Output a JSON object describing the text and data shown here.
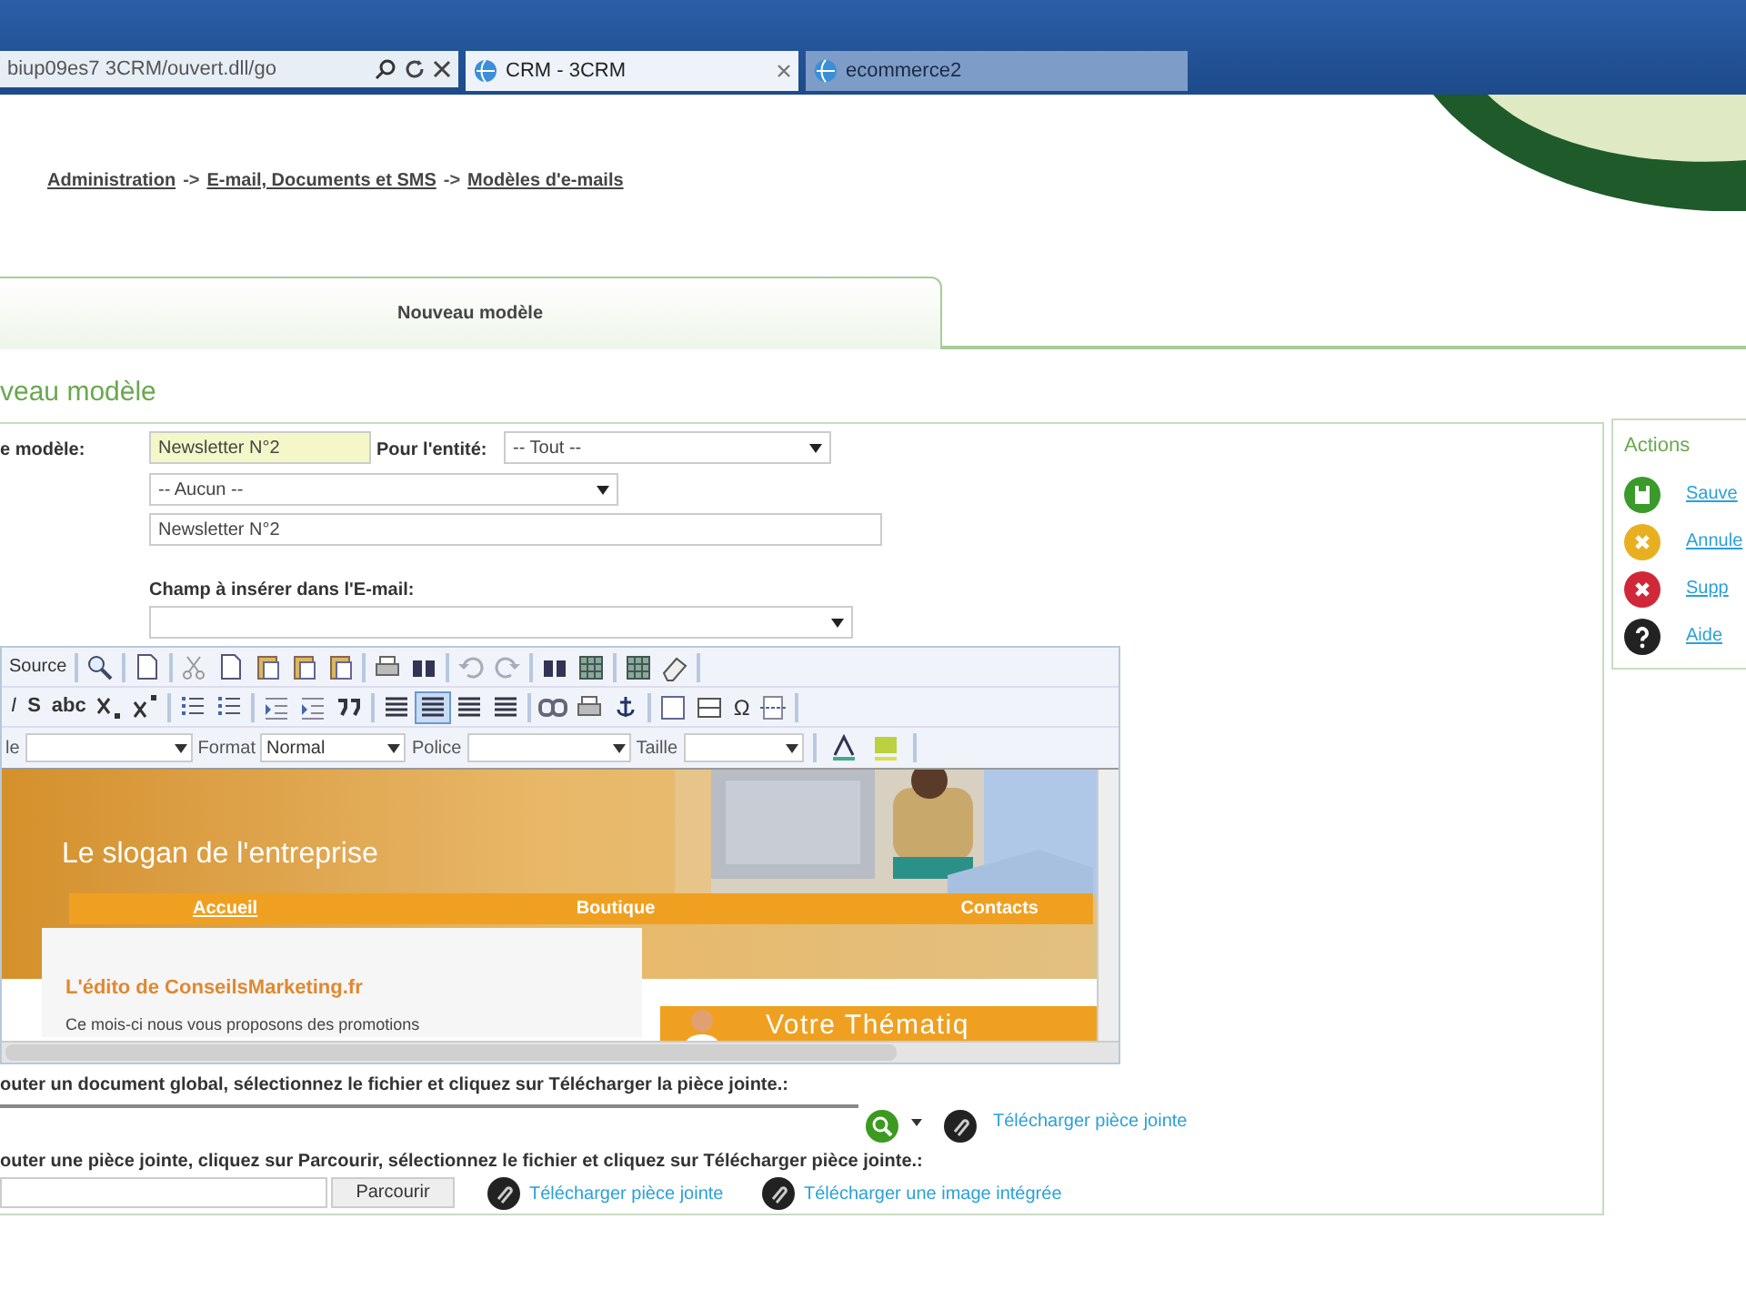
{
  "browser": {
    "address": "biup09es7 3CRM/ouvert.dll/go",
    "tabs": [
      {
        "label": "CRM - 3CRM",
        "selected": true
      },
      {
        "label": "ecommerce2",
        "selected": false
      }
    ]
  },
  "breadcrumb": [
    {
      "label": "Administration",
      "kind": "link"
    },
    {
      "label": "->",
      "kind": "sep"
    },
    {
      "label": "E-mail, Documents et SMS",
      "kind": "link"
    },
    {
      "label": "->",
      "kind": "sep"
    },
    {
      "label": "Modèles d'e-mails",
      "kind": "link"
    }
  ],
  "page_tab": {
    "label": "Nouveau modèle",
    "selected": true
  },
  "heading": "veau modèle",
  "form": {
    "name_label": "e modèle:",
    "name_value": "Newsletter N°2",
    "entity_label": "Pour l'entité:",
    "entity_value": "-- Tout --",
    "category_value": "-- Aucun --",
    "subject_value": "Newsletter N°2",
    "insert_label": "Champ à insérer dans l'E-mail:"
  },
  "editor": {
    "source_label": "Source",
    "format_texts": [
      "I",
      "S",
      "abc"
    ],
    "special_char": "Ω",
    "align_buttons": [
      {
        "selected": false
      },
      {
        "selected": true
      },
      {
        "selected": false
      },
      {
        "selected": false
      }
    ],
    "style_label": "le",
    "format_label": "Format",
    "format_value": "Normal",
    "font_label": "Police",
    "size_label": "Taille",
    "document": {
      "slogan": "Le slogan de l'entreprise",
      "nav": [
        "Accueil",
        "Boutique",
        "Contacts"
      ],
      "edito_title": "L'édito de ConseilsMarketing.fr",
      "edito_text": "Ce mois-ci nous vous proposons des promotions",
      "theme_title": "Votre Thématiq"
    }
  },
  "attachments": {
    "global_text": "outer un document global, sélectionnez le fichier et cliquez sur Télécharger la pièce jointe.:",
    "global_link": "Télécharger pièce jointe",
    "attach_text": "outer une pièce jointe, cliquez sur Parcourir, sélectionnez le fichier et cliquez sur Télécharger pièce jointe.:",
    "browse_button": "Parcourir",
    "attach_link": "Télécharger pièce jointe",
    "image_link": "Télécharger une image intégrée"
  },
  "actions": {
    "title": "Actions",
    "items": [
      {
        "label": "Sauve",
        "kind": "save",
        "color": "#3a9a2a"
      },
      {
        "label": "Annule",
        "kind": "cancel",
        "color": "#e8b020"
      },
      {
        "label": "Supp",
        "kind": "delete",
        "color": "#d02838"
      },
      {
        "label": "Aide",
        "kind": "help",
        "color": "#222222"
      }
    ]
  }
}
